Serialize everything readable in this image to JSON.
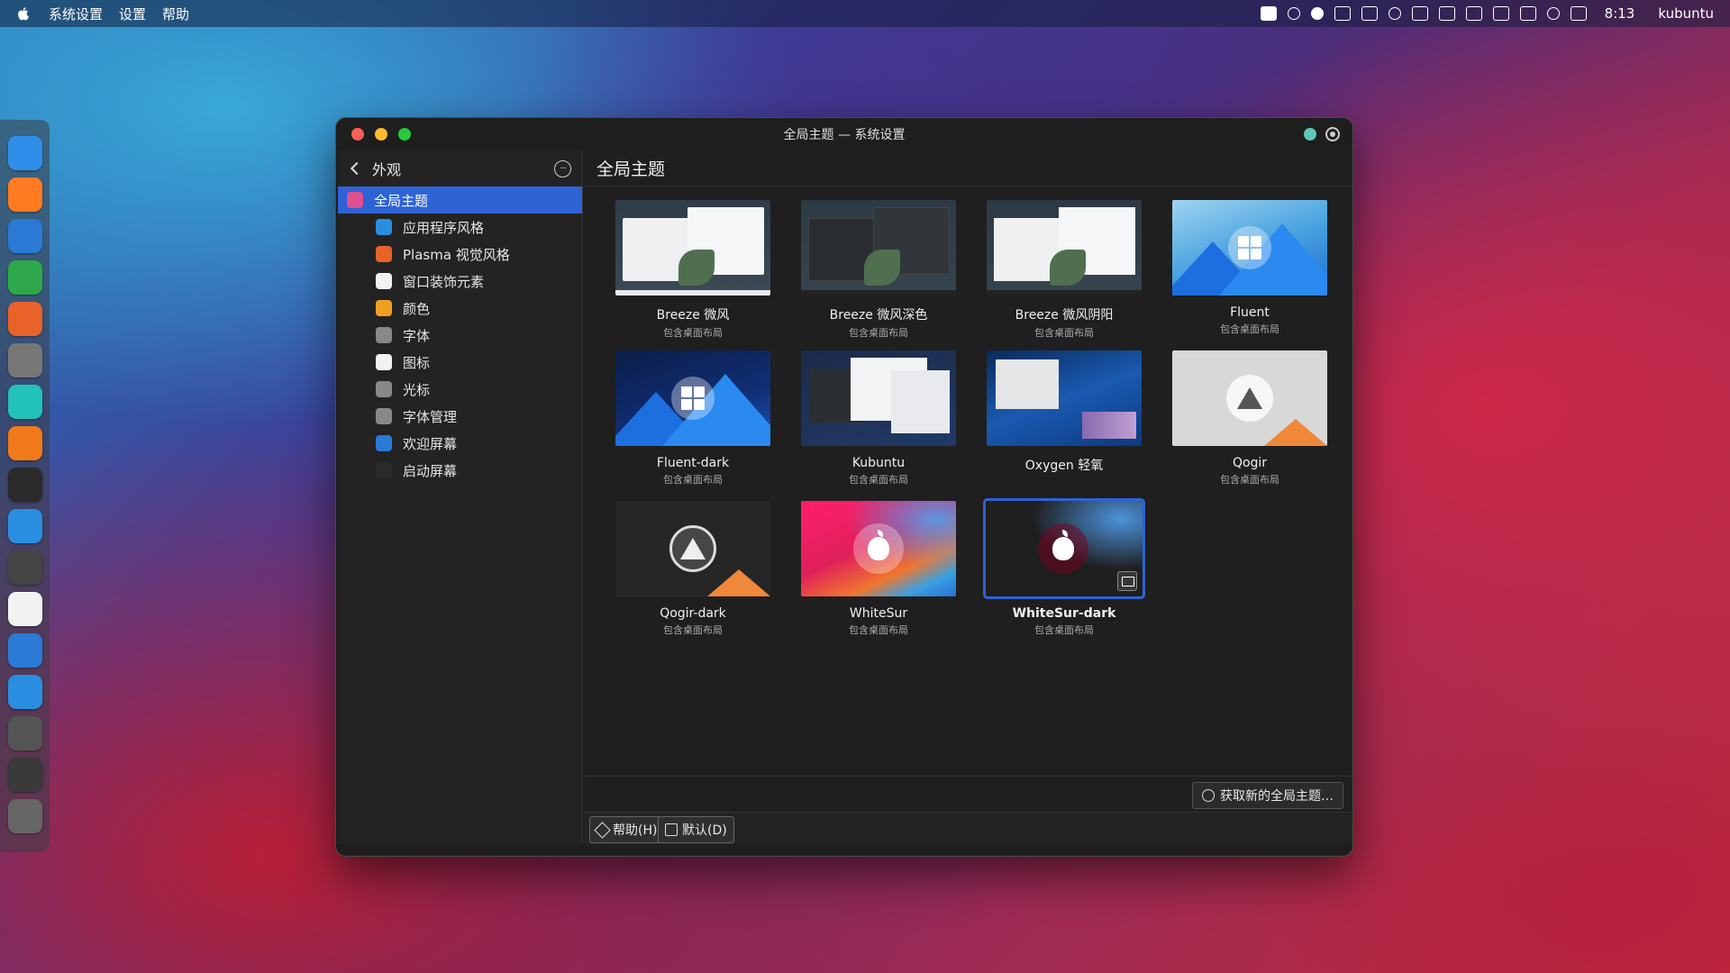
{
  "menubar": {
    "menus": [
      "系统设置",
      "设置",
      "帮助"
    ],
    "clock": "8:13",
    "user": "kubuntu",
    "tray_icons": [
      "command-icon",
      "bell-icon",
      "cloud-icon",
      "screen-share-icon",
      "clipboard-icon",
      "bulb-icon",
      "drive-icon",
      "display-icon",
      "info-icon",
      "monitor-icon",
      "screen-icon",
      "volume-icon",
      "battery-icon"
    ]
  },
  "dock": {
    "apps": [
      {
        "name": "files-icon",
        "color": "#2f8fe8"
      },
      {
        "name": "firefox-icon",
        "color": "#ff7b22"
      },
      {
        "name": "writer-icon",
        "color": "#2a7ad6"
      },
      {
        "name": "calc-icon",
        "color": "#2ea84a"
      },
      {
        "name": "impress-icon",
        "color": "#e8622a"
      },
      {
        "name": "gimp-icon",
        "color": "#777777"
      },
      {
        "name": "music-icon",
        "color": "#22c2b8"
      },
      {
        "name": "vlc-icon",
        "color": "#f07a1a"
      },
      {
        "name": "terminal-icon",
        "color": "#2a2a2a"
      },
      {
        "name": "kite-icon",
        "color": "#2a8ee0"
      },
      {
        "name": "calculator-icon",
        "color": "#444444"
      },
      {
        "name": "screenshot-icon",
        "color": "#f2f2f2"
      },
      {
        "name": "discover-icon",
        "color": "#2a7ad6"
      },
      {
        "name": "discover-download-icon",
        "color": "#2a8ee0"
      },
      {
        "name": "settings-icon",
        "color": "#555555"
      },
      {
        "name": "window-icon",
        "color": "#3a3a3a"
      },
      {
        "name": "trash-icon",
        "color": "#666666"
      }
    ]
  },
  "window": {
    "title": "全局主题 — 系统设置"
  },
  "sidebar": {
    "back_label": "外观",
    "more_label": "···",
    "items": [
      {
        "label": "全局主题",
        "icon_color": "#e05090"
      },
      {
        "label": "应用程序风格",
        "icon_color": "#2a8ee0"
      },
      {
        "label": "Plasma 视觉风格",
        "icon_color": "#e8622a"
      },
      {
        "label": "窗口装饰元素",
        "icon_color": "#f2f2f2"
      },
      {
        "label": "颜色",
        "icon_color": "#f0a020"
      },
      {
        "label": "字体",
        "icon_color": "#888888"
      },
      {
        "label": "图标",
        "icon_color": "#f2f2f2"
      },
      {
        "label": "光标",
        "icon_color": "#888888"
      },
      {
        "label": "字体管理",
        "icon_color": "#888888"
      },
      {
        "label": "欢迎屏幕",
        "icon_color": "#2a7ad6"
      },
      {
        "label": "启动屏幕",
        "icon_color": "#2a2a2a"
      }
    ]
  },
  "main": {
    "title": "全局主题",
    "themes": [
      {
        "name": "Breeze 微风",
        "sub": "包含桌面布局",
        "style": "breeze-light"
      },
      {
        "name": "Breeze 微风深色",
        "sub": "包含桌面布局",
        "style": "breeze-dark"
      },
      {
        "name": "Breeze 微风阴阳",
        "sub": "包含桌面布局",
        "style": "breeze-twilight"
      },
      {
        "name": "Fluent",
        "sub": "包含桌面布局",
        "style": "fluent"
      },
      {
        "name": "Fluent-dark",
        "sub": "包含桌面布局",
        "style": "fluent-dark"
      },
      {
        "name": "Kubuntu",
        "sub": "包含桌面布局",
        "style": "kubuntu"
      },
      {
        "name": "Oxygen 轻氧",
        "sub": "",
        "style": "oxygen"
      },
      {
        "name": "Qogir",
        "sub": "包含桌面布局",
        "style": "qogir"
      },
      {
        "name": "Qogir-dark",
        "sub": "包含桌面布局",
        "style": "qogir-dark"
      },
      {
        "name": "WhiteSur",
        "sub": "包含桌面布局",
        "style": "whitesur"
      },
      {
        "name": "WhiteSur-dark",
        "sub": "包含桌面布局",
        "style": "whitesur-dark",
        "selected": true
      }
    ],
    "get_new_label": "获取新的全局主题…",
    "help_label": "帮助(H)",
    "defaults_label": "默认(D)"
  },
  "colors": {
    "accent": "#2e63d6"
  }
}
